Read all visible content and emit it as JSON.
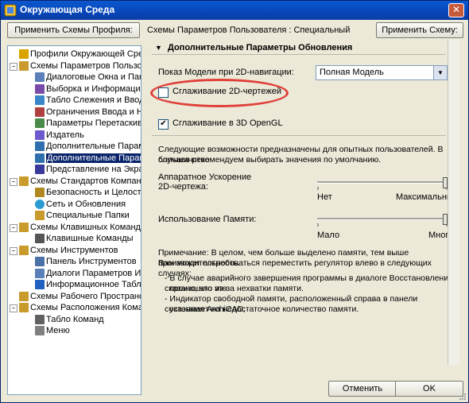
{
  "window": {
    "title": "Окружающая Среда",
    "close": "✕"
  },
  "toolbar": {
    "apply_profile": "Применить Схемы Профиля:",
    "scheme_text": "Схемы Параметров Пользователя : Специальный",
    "apply_scheme": "Применить Схему:"
  },
  "tree": [
    {
      "label": "Профили Окружающей Среды",
      "level": 0,
      "icon": "profile-icon"
    },
    {
      "label": "Схемы Параметров Пользоват",
      "level": 0,
      "icon": "folder-icon",
      "expanded": true
    },
    {
      "label": "Диалоговые Окна и Панел",
      "level": 1,
      "icon": "dialog-icon"
    },
    {
      "label": "Выборка и Информация об",
      "level": 1,
      "icon": "selection-icon"
    },
    {
      "label": "Табло Слежения и Ввод Ко",
      "level": 1,
      "icon": "tracker-icon"
    },
    {
      "label": "Ограничения Ввода и Напр",
      "level": 1,
      "icon": "constraint-icon"
    },
    {
      "label": "Параметры Перетаскивани",
      "level": 1,
      "icon": "drag-icon"
    },
    {
      "label": "Издатель",
      "level": 1,
      "icon": "publisher-icon"
    },
    {
      "label": "Дополнительные Парамет",
      "level": 1,
      "icon": "options-icon"
    },
    {
      "label": "Дополнительные Парамет",
      "level": 1,
      "icon": "options-icon",
      "selected": true
    },
    {
      "label": "Представление на Экране",
      "level": 1,
      "icon": "screen-icon"
    },
    {
      "label": "Схемы Стандартов Компании",
      "level": 0,
      "icon": "folder-icon",
      "expanded": true
    },
    {
      "label": "Безопасность и Целостнос",
      "level": 1,
      "icon": "lock-icon"
    },
    {
      "label": "Сеть и Обновления",
      "level": 1,
      "icon": "globe-icon"
    },
    {
      "label": "Специальные Папки",
      "level": 1,
      "icon": "folder-icon"
    },
    {
      "label": "Схемы Клавишных Команд",
      "level": 0,
      "icon": "folder-icon",
      "expanded": true
    },
    {
      "label": "Клавишные Команды",
      "level": 1,
      "icon": "keyboard-icon"
    },
    {
      "label": "Схемы Инструментов",
      "level": 0,
      "icon": "folder-icon",
      "expanded": true
    },
    {
      "label": "Панель Инструментов",
      "level": 1,
      "icon": "toolbar-icon"
    },
    {
      "label": "Диалоги Параметров Инстр",
      "level": 1,
      "icon": "dialog-icon"
    },
    {
      "label": "Информационное Табло",
      "level": 1,
      "icon": "info-icon"
    },
    {
      "label": "Схемы Рабочего Пространства",
      "level": 0,
      "icon": "folder-icon"
    },
    {
      "label": "Схемы Расположения Команд",
      "level": 0,
      "icon": "folder-icon",
      "expanded": true
    },
    {
      "label": "Табло Команд",
      "level": 1,
      "icon": "commands-icon"
    },
    {
      "label": "Меню",
      "level": 1,
      "icon": "menu-icon"
    }
  ],
  "panel": {
    "title": "Дополнительные Параметры Обновления",
    "nav_label": "Показ Модели при 2D-навигации:",
    "nav_value": "Полная Модель",
    "aa2d_label": "Сглаживание 2D-чертежей",
    "aa2d_checked": false,
    "aa3d_label": "Сглаживание в 3D OpenGL",
    "aa3d_checked": true,
    "advanced_text_1": "Следующие возможности предназначены для опытных пользователей. В большинстве",
    "advanced_text_2": "случаев рекомендуем выбирать значения по умолчанию.",
    "accel_label_1": "Аппаратное Ускорение",
    "accel_label_2": "2D-чертежа:",
    "accel_min": "Нет",
    "accel_max": "Максимальный",
    "accel_value_pct": 100,
    "mem_label": "Использование Памяти:",
    "mem_min": "Мало",
    "mem_max": "Много",
    "mem_value_pct": 100,
    "note_1": "Примечание: В целом, чем больше выделено памяти, тем выше производительность.",
    "note_2": "Вам может потребоваться переместить регулятор влево в следующих случаях:",
    "bullet_1a": "- В случае аварийного завершения программы в диалоге Восстановления сказано, что это",
    "bullet_1b": "произошло из-за нехватки памяти.",
    "bullet_2a": "- Индикатор свободной памяти, расположенный справа в панели состояния ArchiCAD,",
    "bullet_2b": "указывает на недостаточное количество памяти."
  },
  "buttons": {
    "cancel": "Отменить",
    "ok": "OK"
  },
  "colors": {
    "title_bar": "#0a52c8",
    "highlight": "#e0403a",
    "selection": "#0a246a"
  }
}
